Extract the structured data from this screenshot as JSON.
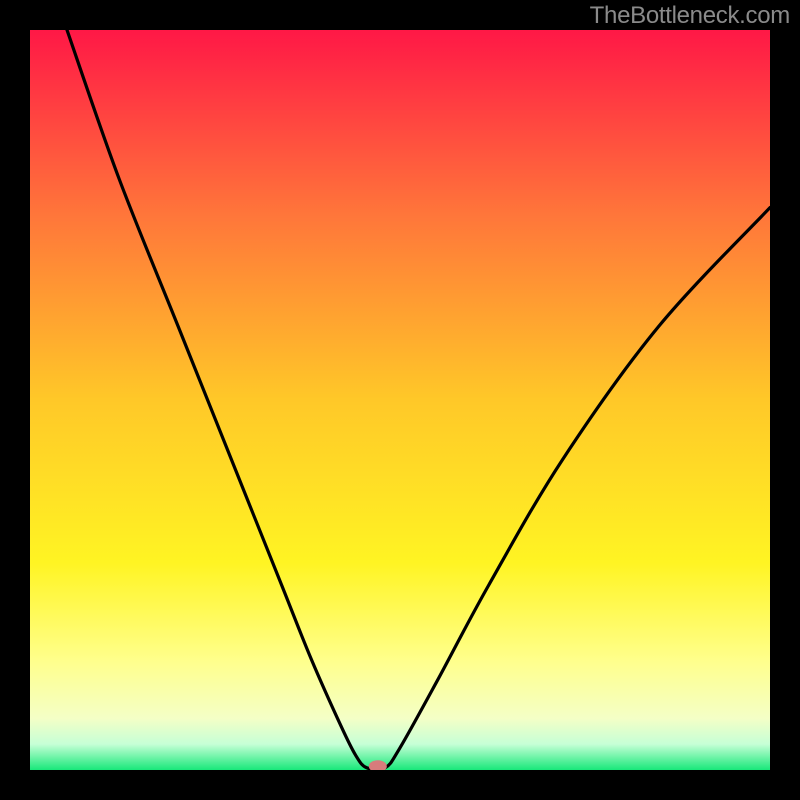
{
  "watermark": "TheBottleneck.com",
  "chart_data": {
    "type": "line",
    "title": "",
    "xlabel": "",
    "ylabel": "",
    "xlim": [
      0,
      100
    ],
    "ylim": [
      0,
      100
    ],
    "series": [
      {
        "name": "curve",
        "points": [
          {
            "x": 5,
            "y": 100
          },
          {
            "x": 12,
            "y": 80
          },
          {
            "x": 20,
            "y": 60
          },
          {
            "x": 28,
            "y": 40
          },
          {
            "x": 34,
            "y": 25
          },
          {
            "x": 38,
            "y": 15
          },
          {
            "x": 42,
            "y": 6
          },
          {
            "x": 44,
            "y": 2
          },
          {
            "x": 45.5,
            "y": 0.3
          },
          {
            "x": 48,
            "y": 0.3
          },
          {
            "x": 50,
            "y": 3
          },
          {
            "x": 55,
            "y": 12
          },
          {
            "x": 62,
            "y": 25
          },
          {
            "x": 72,
            "y": 42
          },
          {
            "x": 85,
            "y": 60
          },
          {
            "x": 100,
            "y": 76
          }
        ]
      }
    ],
    "marker": {
      "x": 47,
      "y": 0.5,
      "color": "#d77c7c"
    },
    "gradient_stops": [
      {
        "offset": 0.0,
        "color": "#ff1846"
      },
      {
        "offset": 0.25,
        "color": "#ff763a"
      },
      {
        "offset": 0.5,
        "color": "#ffc828"
      },
      {
        "offset": 0.72,
        "color": "#fff423"
      },
      {
        "offset": 0.85,
        "color": "#ffff8a"
      },
      {
        "offset": 0.93,
        "color": "#f4ffc6"
      },
      {
        "offset": 0.965,
        "color": "#c6ffd6"
      },
      {
        "offset": 1.0,
        "color": "#18e87a"
      }
    ]
  }
}
